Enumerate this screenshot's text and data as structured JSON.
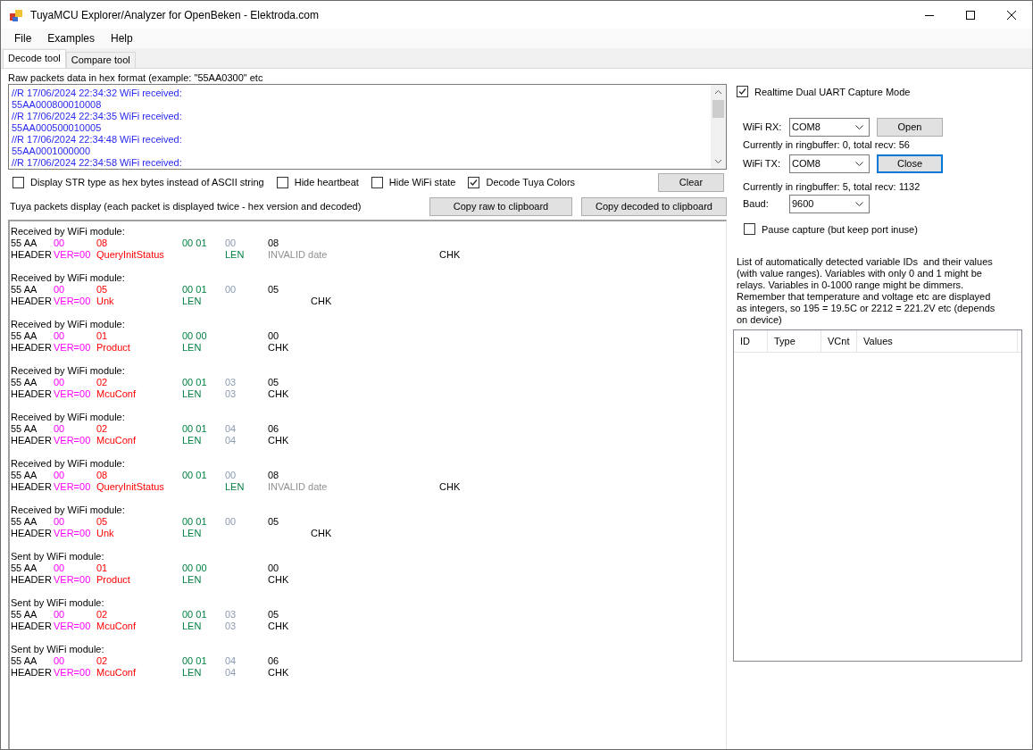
{
  "window": {
    "title": "TuyaMCU Explorer/Analyzer for OpenBeken - Elektroda.com"
  },
  "menu": [
    "File",
    "Examples",
    "Help"
  ],
  "tabs": [
    {
      "label": "Decode tool",
      "selected": true
    },
    {
      "label": "Compare tool",
      "selected": false
    }
  ],
  "raw_packets": {
    "label": "Raw packets data in hex format (example: \"55AA0300\" etc",
    "lines": [
      "//R 17/06/2024 22:34:32 WiFi received:",
      "55AA000800010008",
      "//R 17/06/2024 22:34:35 WiFi received:",
      "55AA000500010005",
      "//R 17/06/2024 22:34:48 WiFi received:",
      "55AA0001000000",
      "//R 17/06/2024 22:34:58 WiFi received:"
    ]
  },
  "options": [
    {
      "label": "Display STR type as hex bytes instead of ASCII string",
      "checked": false
    },
    {
      "label": "Hide heartbeat",
      "checked": false
    },
    {
      "label": "Hide WiFi state",
      "checked": false
    },
    {
      "label": "Decode Tuya Colors",
      "checked": true
    }
  ],
  "clear_button": "Clear",
  "packets_label": "Tuya packets display (each packet is displayed twice - hex version and decoded)",
  "copy_buttons": [
    "Copy raw to clipboard",
    "Copy decoded to clipboard"
  ],
  "packets": [
    {
      "title": "Received by WiFi module:",
      "rows": [
        [
          {
            "text": "55 AA",
            "kind": "header"
          },
          {
            "text": "00",
            "kind": "version"
          },
          {
            "text": "08",
            "kind": "command"
          },
          {
            "text": ""
          },
          {
            "text": "00 01",
            "kind": "length"
          },
          {
            "text": "00",
            "kind": "data"
          },
          {
            "text": "08",
            "kind": "checksum"
          }
        ],
        [
          {
            "text": "HEADER",
            "kind": "header"
          },
          {
            "text": "VER=00",
            "kind": "version"
          },
          {
            "text": "QueryInitStatus",
            "kind": "command"
          },
          {
            "text": ""
          },
          {
            "text": ""
          },
          {
            "text": "LEN",
            "kind": "length"
          },
          {
            "text": "INVALID date",
            "kind": "invalid"
          },
          {
            "text": ""
          },
          {
            "text": ""
          },
          {
            "text": ""
          },
          {
            "text": "CHK",
            "kind": "checksum"
          }
        ]
      ]
    },
    {
      "title": "Received by WiFi module:",
      "rows": [
        [
          {
            "text": "55 AA",
            "kind": "header"
          },
          {
            "text": "00",
            "kind": "version"
          },
          {
            "text": "05",
            "kind": "command"
          },
          {
            "text": ""
          },
          {
            "text": "00 01",
            "kind": "length"
          },
          {
            "text": "00",
            "kind": "data"
          },
          {
            "text": "05",
            "kind": "checksum"
          }
        ],
        [
          {
            "text": "HEADER",
            "kind": "header"
          },
          {
            "text": "VER=00",
            "kind": "version"
          },
          {
            "text": "Unk",
            "kind": "command"
          },
          {
            "text": ""
          },
          {
            "text": "LEN",
            "kind": "length"
          },
          {
            "text": ""
          },
          {
            "text": ""
          },
          {
            "text": "CHK",
            "kind": "checksum"
          }
        ]
      ]
    },
    {
      "title": "Received by WiFi module:",
      "rows": [
        [
          {
            "text": "55 AA",
            "kind": "header"
          },
          {
            "text": "00",
            "kind": "version"
          },
          {
            "text": "01",
            "kind": "command"
          },
          {
            "text": ""
          },
          {
            "text": "00 00",
            "kind": "length"
          },
          {
            "text": ""
          },
          {
            "text": "00",
            "kind": "checksum"
          }
        ],
        [
          {
            "text": "HEADER",
            "kind": "header"
          },
          {
            "text": "VER=00",
            "kind": "version"
          },
          {
            "text": "Product",
            "kind": "command"
          },
          {
            "text": ""
          },
          {
            "text": "LEN",
            "kind": "length"
          },
          {
            "text": ""
          },
          {
            "text": "CHK",
            "kind": "checksum"
          }
        ]
      ]
    },
    {
      "title": "Received by WiFi module:",
      "rows": [
        [
          {
            "text": "55 AA",
            "kind": "header"
          },
          {
            "text": "00",
            "kind": "version"
          },
          {
            "text": "02",
            "kind": "command"
          },
          {
            "text": ""
          },
          {
            "text": "00 01",
            "kind": "length"
          },
          {
            "text": "03",
            "kind": "data"
          },
          {
            "text": "05",
            "kind": "checksum"
          }
        ],
        [
          {
            "text": "HEADER",
            "kind": "header"
          },
          {
            "text": "VER=00",
            "kind": "version"
          },
          {
            "text": "McuConf",
            "kind": "command"
          },
          {
            "text": ""
          },
          {
            "text": "LEN",
            "kind": "length"
          },
          {
            "text": "03",
            "kind": "data"
          },
          {
            "text": "CHK",
            "kind": "checksum"
          }
        ]
      ]
    },
    {
      "title": "Received by WiFi module:",
      "rows": [
        [
          {
            "text": "55 AA",
            "kind": "header"
          },
          {
            "text": "00",
            "kind": "version"
          },
          {
            "text": "02",
            "kind": "command"
          },
          {
            "text": ""
          },
          {
            "text": "00 01",
            "kind": "length"
          },
          {
            "text": "04",
            "kind": "data"
          },
          {
            "text": "06",
            "kind": "checksum"
          }
        ],
        [
          {
            "text": "HEADER",
            "kind": "header"
          },
          {
            "text": "VER=00",
            "kind": "version"
          },
          {
            "text": "McuConf",
            "kind": "command"
          },
          {
            "text": ""
          },
          {
            "text": "LEN",
            "kind": "length"
          },
          {
            "text": "04",
            "kind": "data"
          },
          {
            "text": "CHK",
            "kind": "checksum"
          }
        ]
      ]
    },
    {
      "title": "Received by WiFi module:",
      "rows": [
        [
          {
            "text": "55 AA",
            "kind": "header"
          },
          {
            "text": "00",
            "kind": "version"
          },
          {
            "text": "08",
            "kind": "command"
          },
          {
            "text": ""
          },
          {
            "text": "00 01",
            "kind": "length"
          },
          {
            "text": "00",
            "kind": "data"
          },
          {
            "text": "08",
            "kind": "checksum"
          }
        ],
        [
          {
            "text": "HEADER",
            "kind": "header"
          },
          {
            "text": "VER=00",
            "kind": "version"
          },
          {
            "text": "QueryInitStatus",
            "kind": "command"
          },
          {
            "text": ""
          },
          {
            "text": ""
          },
          {
            "text": "LEN",
            "kind": "length"
          },
          {
            "text": "INVALID date",
            "kind": "invalid"
          },
          {
            "text": ""
          },
          {
            "text": ""
          },
          {
            "text": ""
          },
          {
            "text": "CHK",
            "kind": "checksum"
          }
        ]
      ]
    },
    {
      "title": "Received by WiFi module:",
      "rows": [
        [
          {
            "text": "55 AA",
            "kind": "header"
          },
          {
            "text": "00",
            "kind": "version"
          },
          {
            "text": "05",
            "kind": "command"
          },
          {
            "text": ""
          },
          {
            "text": "00 01",
            "kind": "length"
          },
          {
            "text": "00",
            "kind": "data"
          },
          {
            "text": "05",
            "kind": "checksum"
          }
        ],
        [
          {
            "text": "HEADER",
            "kind": "header"
          },
          {
            "text": "VER=00",
            "kind": "version"
          },
          {
            "text": "Unk",
            "kind": "command"
          },
          {
            "text": ""
          },
          {
            "text": "LEN",
            "kind": "length"
          },
          {
            "text": ""
          },
          {
            "text": ""
          },
          {
            "text": "CHK",
            "kind": "checksum"
          }
        ]
      ]
    },
    {
      "title": "Sent by WiFi module:",
      "rows": [
        [
          {
            "text": "55 AA",
            "kind": "header"
          },
          {
            "text": "00",
            "kind": "version"
          },
          {
            "text": "01",
            "kind": "command"
          },
          {
            "text": ""
          },
          {
            "text": "00 00",
            "kind": "length"
          },
          {
            "text": ""
          },
          {
            "text": "00",
            "kind": "checksum"
          }
        ],
        [
          {
            "text": "HEADER",
            "kind": "header"
          },
          {
            "text": "VER=00",
            "kind": "version"
          },
          {
            "text": "Product",
            "kind": "command"
          },
          {
            "text": ""
          },
          {
            "text": "LEN",
            "kind": "length"
          },
          {
            "text": ""
          },
          {
            "text": "CHK",
            "kind": "checksum"
          }
        ]
      ]
    },
    {
      "title": "Sent by WiFi module:",
      "rows": [
        [
          {
            "text": "55 AA",
            "kind": "header"
          },
          {
            "text": "00",
            "kind": "version"
          },
          {
            "text": "02",
            "kind": "command"
          },
          {
            "text": ""
          },
          {
            "text": "00 01",
            "kind": "length"
          },
          {
            "text": "03",
            "kind": "data"
          },
          {
            "text": "05",
            "kind": "checksum"
          }
        ],
        [
          {
            "text": "HEADER",
            "kind": "header"
          },
          {
            "text": "VER=00",
            "kind": "version"
          },
          {
            "text": "McuConf",
            "kind": "command"
          },
          {
            "text": ""
          },
          {
            "text": "LEN",
            "kind": "length"
          },
          {
            "text": "03",
            "kind": "data"
          },
          {
            "text": "CHK",
            "kind": "checksum"
          }
        ]
      ]
    },
    {
      "title": "Sent by WiFi module:",
      "rows": [
        [
          {
            "text": "55 AA",
            "kind": "header"
          },
          {
            "text": "00",
            "kind": "version"
          },
          {
            "text": "02",
            "kind": "command"
          },
          {
            "text": ""
          },
          {
            "text": "00 01",
            "kind": "length"
          },
          {
            "text": "04",
            "kind": "data"
          },
          {
            "text": "06",
            "kind": "checksum"
          }
        ],
        [
          {
            "text": "HEADER",
            "kind": "header"
          },
          {
            "text": "VER=00",
            "kind": "version"
          },
          {
            "text": "McuConf",
            "kind": "command"
          },
          {
            "text": ""
          },
          {
            "text": "LEN",
            "kind": "length"
          },
          {
            "text": "04",
            "kind": "data"
          },
          {
            "text": "CHK",
            "kind": "checksum"
          }
        ]
      ]
    }
  ],
  "capture": {
    "realtime": {
      "label": "Realtime Dual UART Capture Mode",
      "checked": true
    },
    "ports": [
      {
        "label": "WiFi RX:",
        "value": "COM8",
        "button": "Open",
        "focused": false,
        "status": "Currently in ringbuffer: 0, total recv: 56"
      },
      {
        "label": "WiFi TX:",
        "value": "COM8",
        "button": "Close",
        "focused": true,
        "status": "Currently in ringbuffer: 5, total recv: 1132"
      }
    ],
    "baud": {
      "label": "Baud:",
      "value": "9600"
    },
    "pause": {
      "label": "Pause capture (but keep port inuse)",
      "checked": false
    }
  },
  "variables": {
    "description": "List of automatically detected variable IDs  and their values (with value ranges). Variables with only 0 and 1 might be relays. Variables in 0-1000 range might be dimmers. Remember that temperature and voltage etc are displayed as integers, so 195 = 19.5C or 2212 = 221.2V etc (depends on device)",
    "columns": [
      "ID",
      "Type",
      "VCnt",
      "Values"
    ]
  }
}
